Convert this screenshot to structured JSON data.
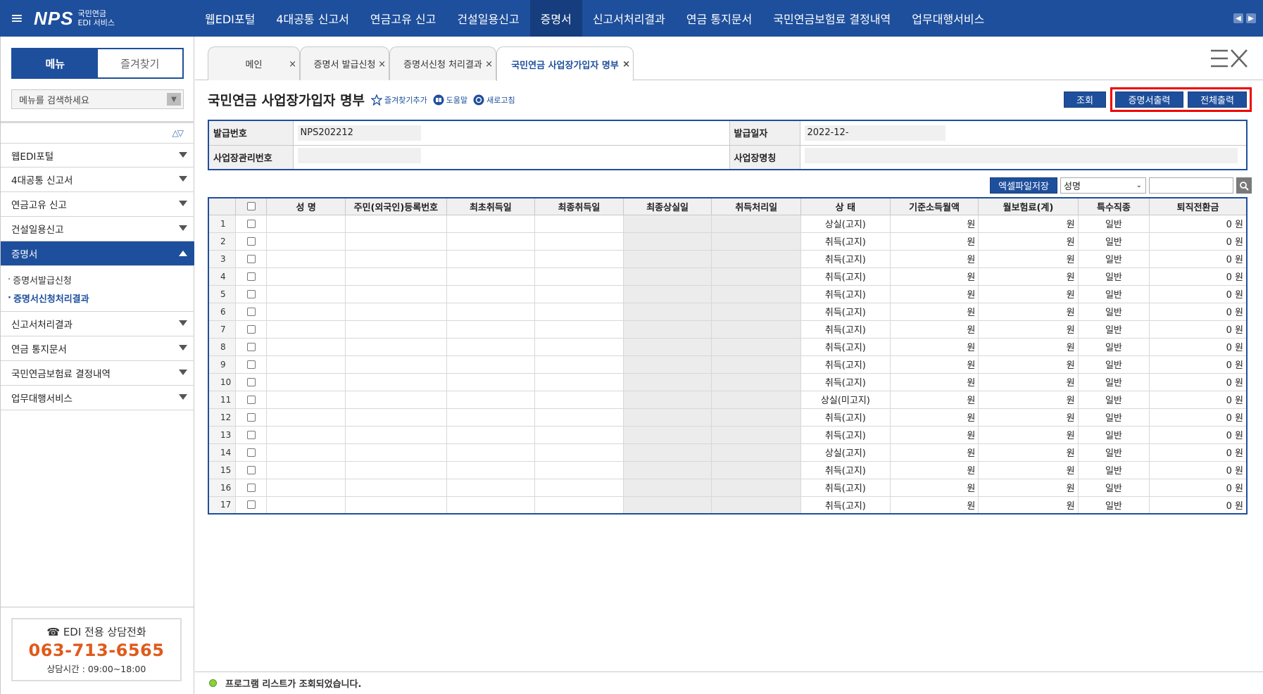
{
  "header": {
    "logo_mark": "NPS",
    "logo_line1": "국민연금",
    "logo_line2": "EDI 서비스",
    "nav": [
      "웹EDI포털",
      "4대공통 신고서",
      "연금고유 신고",
      "건설일용신고",
      "증명서",
      "신고서처리결과",
      "연금 통지문서",
      "국민연금보험료 결정내역",
      "업무대행서비스"
    ],
    "active_nav": 4
  },
  "sidebar": {
    "tab_menu": "메뉴",
    "tab_favorites": "즐겨찾기",
    "search_placeholder": "메뉴를 검색하세요",
    "items_top": [
      "웹EDI포털",
      "4대공통 신고서",
      "연금고유 신고",
      "건설일용신고"
    ],
    "open_item": "증명서",
    "sub_items": [
      "증명서발급신청",
      "증명서신청처리결과"
    ],
    "items_bottom": [
      "신고서처리결과",
      "연금 통지문서",
      "국민연금보험료 결정내역",
      "업무대행서비스"
    ],
    "help_title": "☎ EDI 전용 상담전화",
    "help_phone": "063-713-6565",
    "help_hours": "상담시간 : 09:00~18:00"
  },
  "page_tabs": [
    {
      "label": "메인"
    },
    {
      "label": "증명서 발급신청"
    },
    {
      "label": "증명서신청 처리결과"
    },
    {
      "label": "국민연금 사업장가입자 명부"
    }
  ],
  "page": {
    "title": "국민연금 사업장가입자 명부",
    "link_fav": "즐겨찾기추가",
    "link_help": "도움말",
    "link_refresh": "새로고침",
    "btn_query": "조회",
    "btn_cert_print": "증명서출력",
    "btn_print_all": "전체출력"
  },
  "info": {
    "issue_no_label": "발급번호",
    "issue_no": "NPS202212",
    "issue_date_label": "발급일자",
    "issue_date": "2022-12-",
    "biz_no_label": "사업장관리번호",
    "biz_name_label": "사업장명칭"
  },
  "grid_tools": {
    "excel_btn": "엑셀파일저장",
    "select_value": "성명"
  },
  "grid": {
    "headers": [
      "",
      "",
      "성 명",
      "주민(외국인)등록번호",
      "최초취득일",
      "최종취득일",
      "최종상실일",
      "취득처리일",
      "상 태",
      "기준소득월액",
      "월보험료(계)",
      "특수직종",
      "퇴직전환금"
    ],
    "rows": [
      {
        "no": "1",
        "status": "상실(고지)",
        "unit1": "원",
        "unit2": "원",
        "job": "일반",
        "refund": "0 원"
      },
      {
        "no": "2",
        "status": "취득(고지)",
        "unit1": "원",
        "unit2": "원",
        "job": "일반",
        "refund": "0 원"
      },
      {
        "no": "3",
        "status": "취득(고지)",
        "unit1": "원",
        "unit2": "원",
        "job": "일반",
        "refund": "0 원"
      },
      {
        "no": "4",
        "status": "취득(고지)",
        "unit1": "원",
        "unit2": "원",
        "job": "일반",
        "refund": "0 원"
      },
      {
        "no": "5",
        "status": "취득(고지)",
        "unit1": "원",
        "unit2": "원",
        "job": "일반",
        "refund": "0 원"
      },
      {
        "no": "6",
        "status": "취득(고지)",
        "unit1": "원",
        "unit2": "원",
        "job": "일반",
        "refund": "0 원"
      },
      {
        "no": "7",
        "status": "취득(고지)",
        "unit1": "원",
        "unit2": "원",
        "job": "일반",
        "refund": "0 원"
      },
      {
        "no": "8",
        "status": "취득(고지)",
        "unit1": "원",
        "unit2": "원",
        "job": "일반",
        "refund": "0 원"
      },
      {
        "no": "9",
        "status": "취득(고지)",
        "unit1": "원",
        "unit2": "원",
        "job": "일반",
        "refund": "0 원"
      },
      {
        "no": "10",
        "status": "취득(고지)",
        "unit1": "원",
        "unit2": "원",
        "job": "일반",
        "refund": "0 원"
      },
      {
        "no": "11",
        "status": "상실(미고지)",
        "unit1": "원",
        "unit2": "원",
        "job": "일반",
        "refund": "0 원"
      },
      {
        "no": "12",
        "status": "취득(고지)",
        "unit1": "원",
        "unit2": "원",
        "job": "일반",
        "refund": "0 원"
      },
      {
        "no": "13",
        "status": "취득(고지)",
        "unit1": "원",
        "unit2": "원",
        "job": "일반",
        "refund": "0 원"
      },
      {
        "no": "14",
        "status": "상실(고지)",
        "unit1": "원",
        "unit2": "원",
        "job": "일반",
        "refund": "0 원"
      },
      {
        "no": "15",
        "status": "취득(고지)",
        "unit1": "원",
        "unit2": "원",
        "job": "일반",
        "refund": "0 원"
      },
      {
        "no": "16",
        "status": "취득(고지)",
        "unit1": "원",
        "unit2": "원",
        "job": "일반",
        "refund": "0 원"
      },
      {
        "no": "17",
        "status": "취득(고지)",
        "unit1": "원",
        "unit2": "원",
        "job": "일반",
        "refund": "0 원"
      }
    ]
  },
  "status_bar": {
    "message": "프로그램 리스트가 조회되었습니다."
  },
  "colors": {
    "primary": "#1e4f9c",
    "highlight": "#ee0000",
    "phone": "#e05a1c",
    "status_ok": "#8ccf3f"
  }
}
